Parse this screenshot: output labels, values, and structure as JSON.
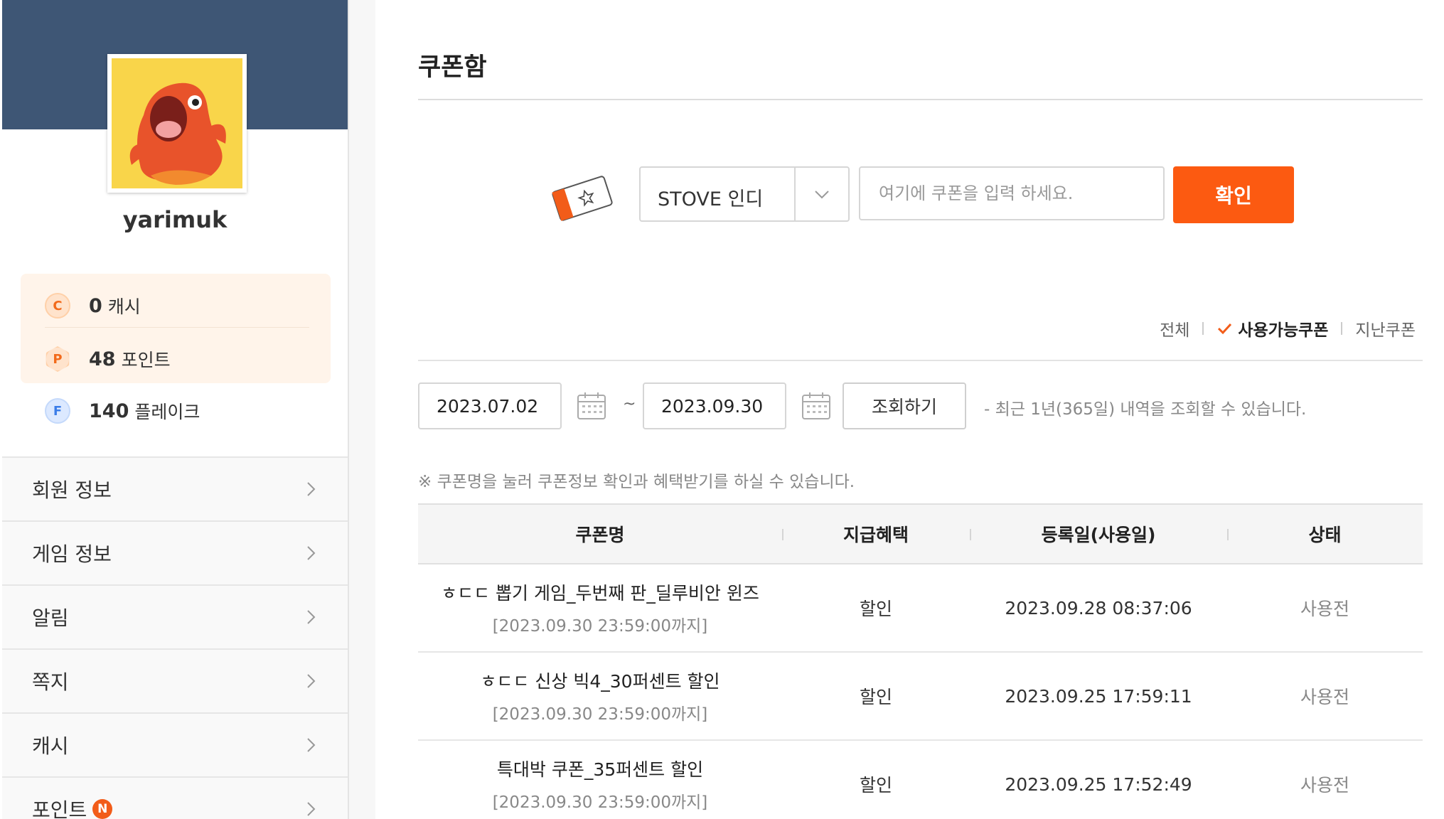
{
  "sidebar": {
    "username": "yarimuk",
    "wallet": {
      "cash": {
        "icon_letter": "C",
        "amount": "0",
        "unit": "캐시"
      },
      "point": {
        "icon_letter": "P",
        "amount": "48",
        "unit": "포인트"
      }
    },
    "flake": {
      "icon_letter": "F",
      "amount": "140",
      "unit": "플레이크"
    },
    "menu": [
      {
        "label": "회원 정보"
      },
      {
        "label": "게임 정보"
      },
      {
        "label": "알림"
      },
      {
        "label": "쪽지"
      },
      {
        "label": "캐시"
      },
      {
        "label": "포인트",
        "badge": "N"
      }
    ]
  },
  "main": {
    "title": "쿠폰함",
    "coupon_form": {
      "select_value": "STOVE 인디",
      "input_placeholder": "여기에 쿠폰을 입력 하세요.",
      "confirm_label": "확인"
    },
    "filters": {
      "all": "전체",
      "available": "사용가능쿠폰",
      "expired": "지난쿠폰",
      "active": "available"
    },
    "date_range": {
      "start": "2023.07.02",
      "tilde": "~",
      "end": "2023.09.30",
      "search_label": "조회하기",
      "note": "- 최근 1년(365일) 내역을 조회할 수 있습니다."
    },
    "notice": "※ 쿠폰명을 눌러 쿠폰정보 확인과 혜택받기를 하실 수 있습니다.",
    "table": {
      "headers": [
        "쿠폰명",
        "지급혜택",
        "등록일(사용일)",
        "상태"
      ],
      "rows": [
        {
          "name": "ㅎㄷㄷ 뽑기 게임_두번째 판_딜루비안 윈즈",
          "expiry": "[2023.09.30 23:59:00까지]",
          "benefit": "할인",
          "date": "2023.09.28 08:37:06",
          "status": "사용전"
        },
        {
          "name": "ㅎㄷㄷ 신상 빅4_30퍼센트 할인",
          "expiry": "[2023.09.30 23:59:00까지]",
          "benefit": "할인",
          "date": "2023.09.25 17:59:11",
          "status": "사용전"
        },
        {
          "name": "특대박 쿠폰_35퍼센트 할인",
          "expiry": "[2023.09.30 23:59:00까지]",
          "benefit": "할인",
          "date": "2023.09.25 17:52:49",
          "status": "사용전"
        }
      ]
    }
  },
  "colors": {
    "accent": "#fc5a11",
    "profile_header": "#3e5675",
    "wallet_bg": "#fff4ea"
  }
}
